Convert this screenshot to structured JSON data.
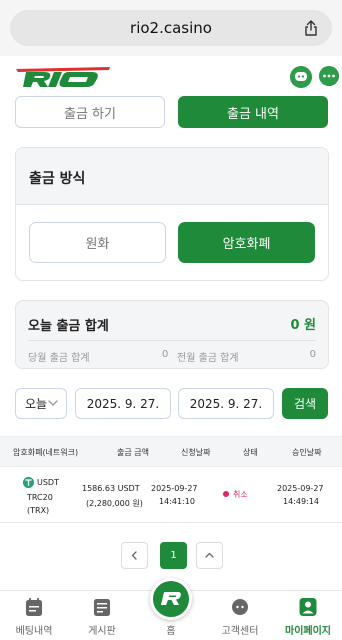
{
  "browser": {
    "url": "rio2.casino"
  },
  "tabs": {
    "withdraw_label": "출금 하기",
    "history_label": "출금 내역"
  },
  "method": {
    "title": "출금 방식",
    "fiat_label": "원화",
    "crypto_label": "암호화폐"
  },
  "summary": {
    "title": "오늘 출금 합계",
    "total": "0 원",
    "month_label": "당월 출금 합계",
    "month_value": "0",
    "prev_label": "전월 출금 합계",
    "prev_value": "0"
  },
  "filter": {
    "period": "오늘",
    "start_date": "2025. 9. 27.",
    "end_date": "2025. 9. 27.",
    "search_label": "검색"
  },
  "table": {
    "headers": [
      "암호화폐(네트워크)",
      "출금 금액",
      "신청날짜",
      "상태",
      "승인날짜"
    ],
    "rows": [
      {
        "coin": "USDT",
        "network": "TRC20",
        "network_sub": "(TRX)",
        "amount": "1586.63 USDT",
        "amount_krw": "(2,280,000 원)",
        "request_date": "2025-09-27",
        "request_time": "14:41:10",
        "status": "취소",
        "approve_date": "2025-09-27",
        "approve_time": "14:49:14"
      }
    ]
  },
  "pagination": {
    "current": "1"
  },
  "nav": {
    "items": [
      "베팅내역",
      "게시판",
      "홈",
      "고객센터",
      "마이페이지"
    ]
  },
  "colors": {
    "accent": "#1f8a3a",
    "cancel": "#e0245e"
  }
}
